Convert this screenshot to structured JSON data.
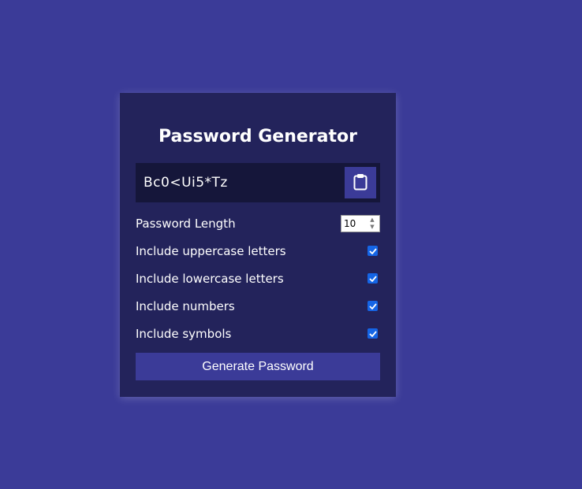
{
  "app": {
    "title": "Password Generator"
  },
  "result": {
    "password": "Bc0<Ui5*Tz",
    "copy_icon": "clipboard-icon"
  },
  "settings": {
    "length": {
      "label": "Password Length",
      "value": "10"
    },
    "options": [
      {
        "label": "Include uppercase letters",
        "checked": true
      },
      {
        "label": "Include lowercase letters",
        "checked": true
      },
      {
        "label": "Include numbers",
        "checked": true
      },
      {
        "label": "Include symbols",
        "checked": true
      }
    ]
  },
  "generate_button": {
    "label": "Generate Password"
  },
  "colors": {
    "background": "#3b3b98",
    "card": "#23235b",
    "result_bg": "#15163a",
    "accent": "#3b3b98",
    "checkbox": "#1565e6"
  }
}
